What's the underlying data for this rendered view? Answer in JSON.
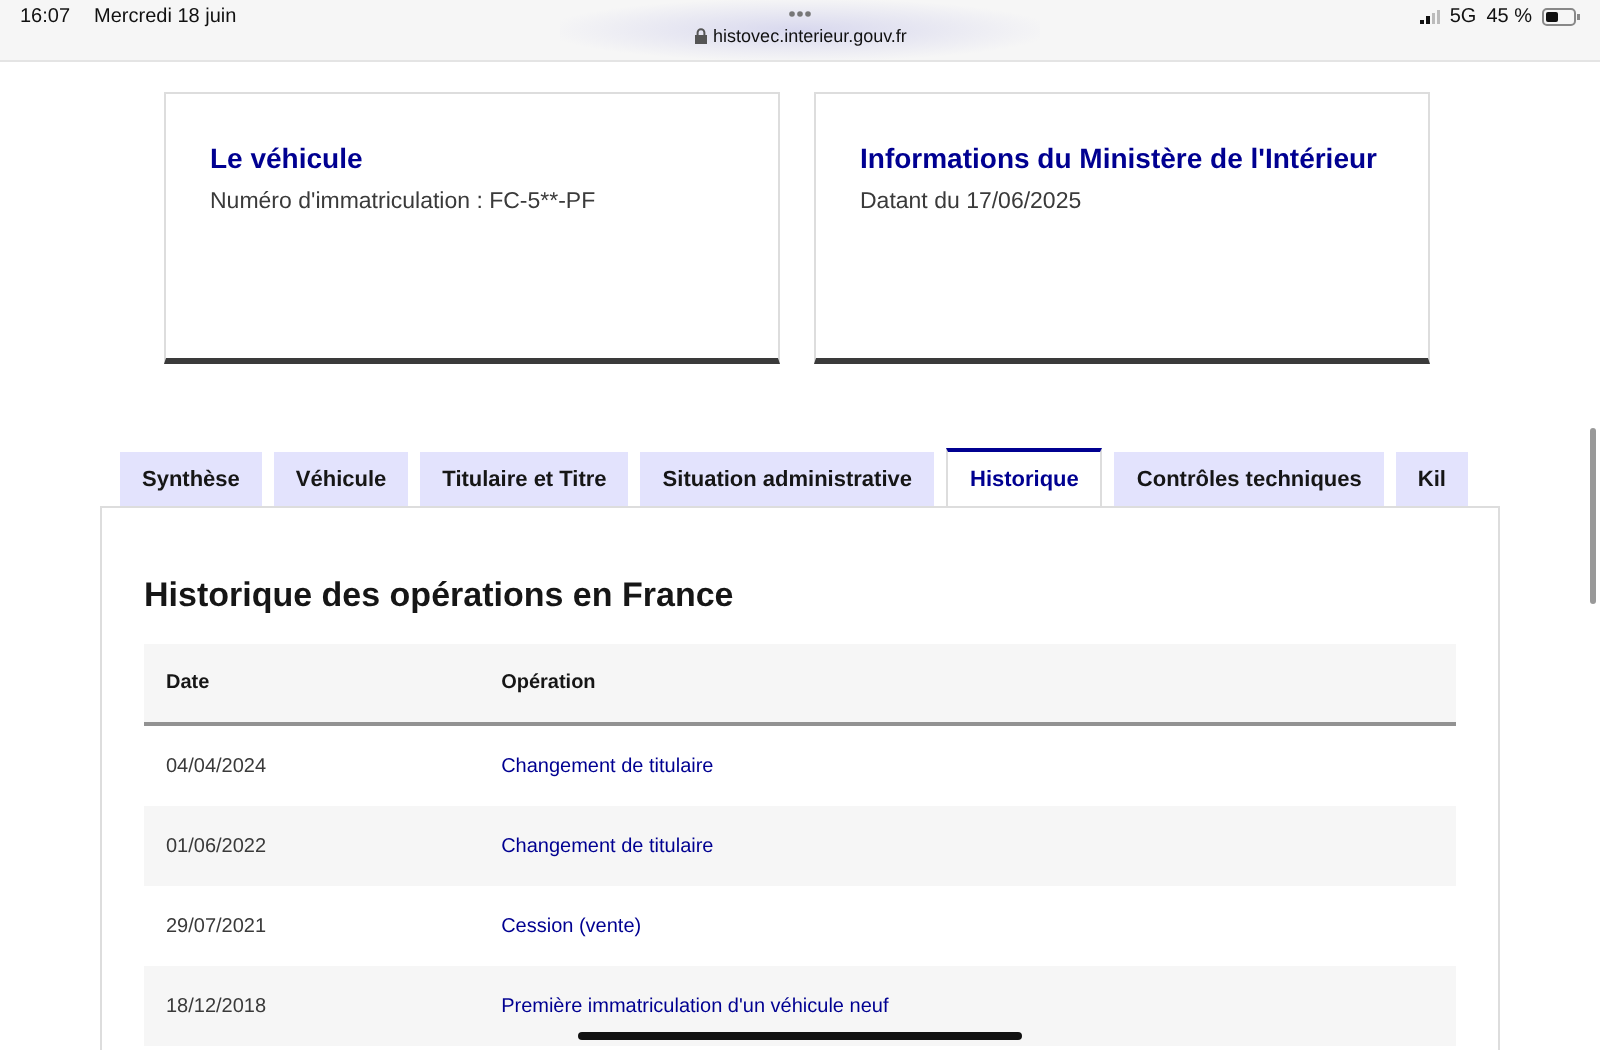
{
  "status_bar": {
    "time": "16:07",
    "date": "Mercredi 18 juin",
    "url": "histovec.interieur.gouv.fr",
    "network": "5G",
    "battery": "45 %"
  },
  "cards": [
    {
      "title": "Le véhicule",
      "text": "Numéro d'immatriculation : FC-5**-PF"
    },
    {
      "title": "Informations du Ministère de l'Intérieur",
      "text": "Datant du 17/06/2025"
    }
  ],
  "tabs": [
    {
      "label": "Synthèse",
      "selected": false
    },
    {
      "label": "Véhicule",
      "selected": false
    },
    {
      "label": "Titulaire et Titre",
      "selected": false
    },
    {
      "label": "Situation administrative",
      "selected": false
    },
    {
      "label": "Historique",
      "selected": true
    },
    {
      "label": "Contrôles techniques",
      "selected": false
    },
    {
      "label": "Kil",
      "selected": false
    }
  ],
  "section_title": "Historique des opérations en France",
  "table": {
    "columns": [
      "Date",
      "Opération"
    ],
    "rows": [
      {
        "date": "04/04/2024",
        "operation": "Changement de titulaire"
      },
      {
        "date": "01/06/2022",
        "operation": "Changement de titulaire"
      },
      {
        "date": "29/07/2021",
        "operation": "Cession (vente)"
      },
      {
        "date": "18/12/2018",
        "operation": "Première immatriculation d'un véhicule neuf"
      }
    ]
  }
}
